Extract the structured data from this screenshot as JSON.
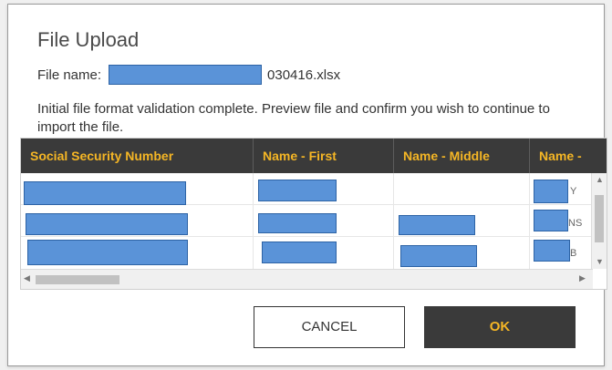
{
  "dialog": {
    "title": "File Upload",
    "file_name_label": "File name:",
    "file_name_suffix": "030416.xlsx",
    "message": "Initial file format validation complete. Preview file and confirm you wish to continue to import the file."
  },
  "grid": {
    "columns": [
      "Social Security Number",
      "Name - First",
      "Name - Middle",
      "Name -"
    ],
    "partial_cell_text": [
      "Y",
      "NS",
      "B"
    ]
  },
  "buttons": {
    "cancel": "CANCEL",
    "ok": "OK"
  },
  "colors": {
    "header_bg": "#3a3a3a",
    "header_text": "#f5b625",
    "redaction": "#5a93d8"
  },
  "icons": {
    "scroll_up": "▲",
    "scroll_down": "▼",
    "scroll_left": "◀",
    "scroll_right": "▶"
  }
}
